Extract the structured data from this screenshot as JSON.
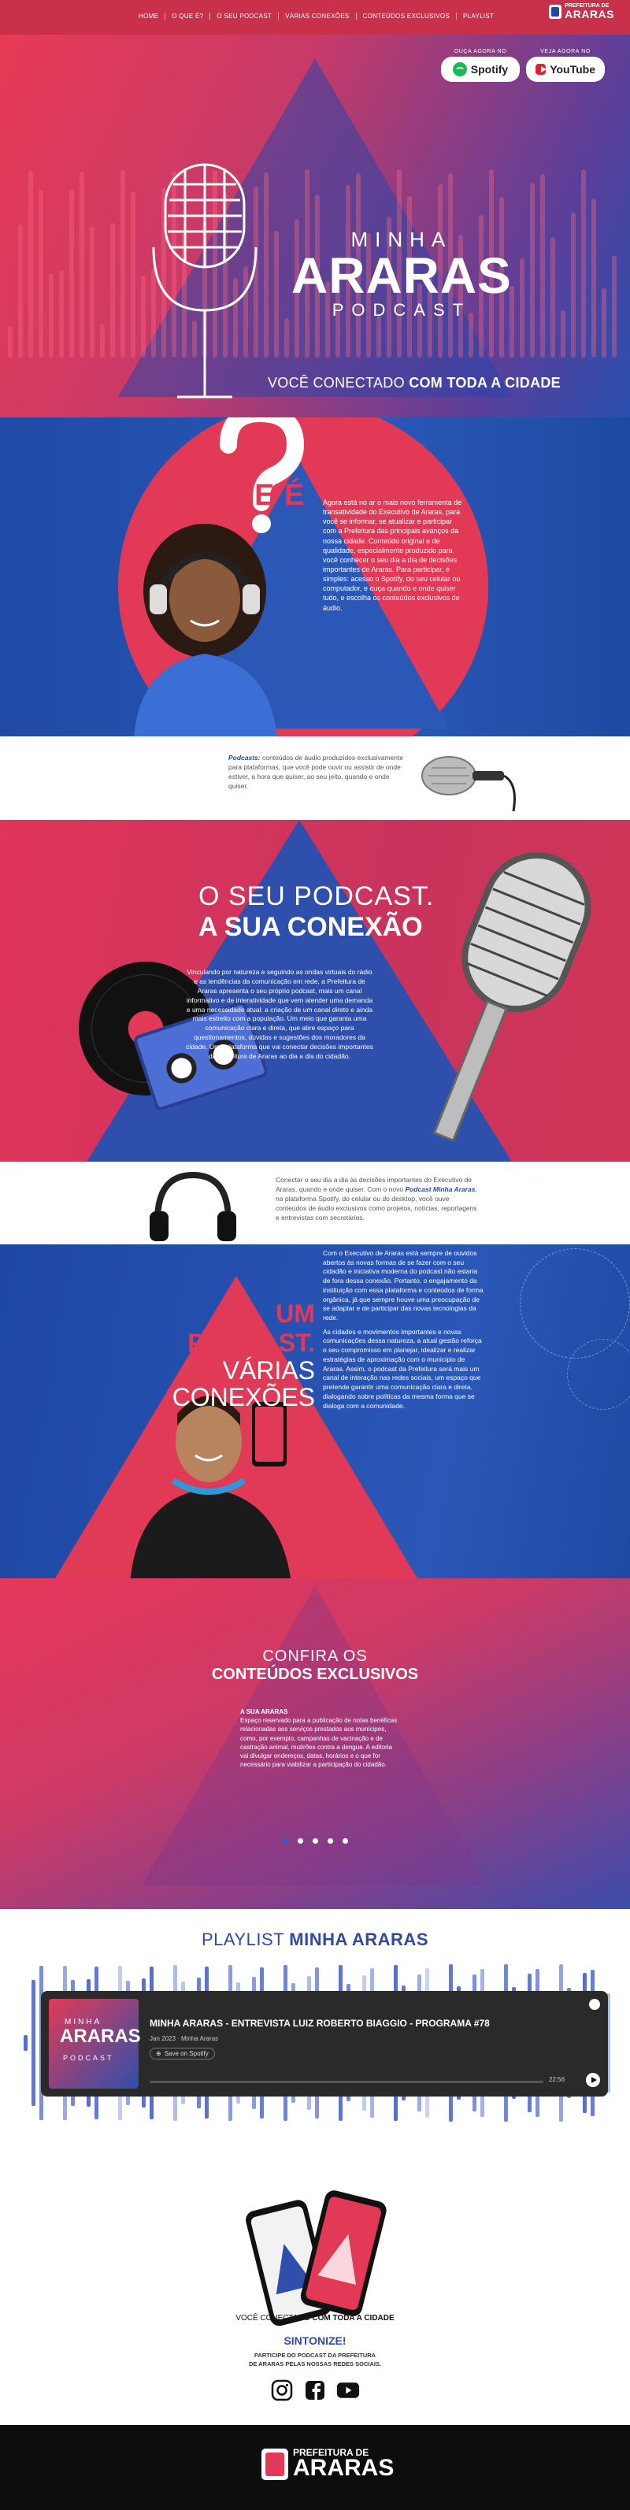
{
  "nav": {
    "links": [
      "HOME",
      "O QUE É?",
      "O SEU PODCAST",
      "VÁRIAS CONEXÕES",
      "CONTEÚDOS EXCLUSIVOS",
      "PLAYLIST"
    ],
    "logo_line1": "PREFEITURA DE",
    "logo_line2": "ARARAS"
  },
  "hero": {
    "spotify_label": "OUÇA AGORA NO",
    "spotify_name": "Spotify",
    "youtube_label": "VEJA AGORA NO",
    "youtube_name": "YouTube",
    "title_top": "MINHA",
    "title_main": "ARARAS",
    "title_bottom": "PODCAST",
    "tagline_part1": "VOCÊ CONECTADO",
    "tagline_part2": "COM TODA A CIDADE"
  },
  "oque": {
    "title": "O QUE É",
    "text": "Agora está no ar o mais novo ferramenta de transatividade do Executivo de Araras, para você se informar, se atualizar e participar com a Prefeitura das principais avanços da nossa cidade. Conteúdo original e de qualidade, especialmente produzido para você conhecer o seu dia a dia de decisões importantes de Araras. Para participar, é simples: acesso o Spotify, do seu celular ou computador, e ouça quando e onde quiser tudo, e escolha os conteúdos exclusivos de áudio.",
    "bottom_lead": "Podcasts:",
    "bottom_text": "conteúdos de áudio produzidos exclusivamente para plataformas, que você pode ouvir ou assistir de onde estiver, a hora que quiser, ao seu jeito, quando e onde quiser."
  },
  "seu": {
    "title_line1": "O SEU PODCAST.",
    "title_line2": "A SUA CONEXÃO",
    "text": "Vinculando por natureza e seguindo as ondas virtuais do rádio e as tendências da comunicação em rede, a Prefeitura de Araras apresenta o seu próprio podcast, mais um canal informativo e de interatividade que vem atender uma demanda e uma necessidade atual: a criação de um canal direto e ainda mais estreito com a população. Um meio que garanta uma comunicação clara e direta, que abre espaço para questionamentos, dúvidas e sugestões dos moradores da cidade. Uma plataforma que vai conectar decisões importantes da Prefeitura de Araras ao dia a dia do cidadão.",
    "bottom_text_start": "Conectar o seu dia a dia às decisões importantes do Executivo de Araras, quando e onde quiser. Com o novo",
    "bottom_lead": "Podcast Minha Araras",
    "bottom_text_end": ", na plataforma Spotify, do celular ou do desktop, você ouve conteúdos de áudio exclusivos como projetos, notícias, reportagens e entrevistas com secretários."
  },
  "um": {
    "title_line1": "UM PODCAST.",
    "title_line2": "VÁRIAS",
    "title_line3": "CONEXÕES",
    "paragraphs": [
      "Com o Executivo de Araras está sempre de ouvidos abertos às novas formas de se fazer com o seu cidadão e iniciativa moderna do podcast não estaria de fora dessa conexão. Portanto, o engajamento da instituição com essa plataforma e conteúdos de forma orgânica, já que sempre houve uma preocupação de se adaptar e de participar das novas tecnologias da rede.",
      "As cidades e movimentos importantes e novas comunicações dessa natureza, a atual gestão reforça o seu compromisso em planejar, idealizar e realizar estratégias de aproximação com o município de Araras. Assim, o podcast da Prefeitura será mais um canal de interação nas redes sociais, um espaço que pretende garantir uma comunicação clara e direta, dialogando sobre políticas da mesma forma que se dialoga com a comunidade."
    ]
  },
  "confira": {
    "title_line1": "CONFIRA OS",
    "title_line2": "CONTEÚDOS EXCLUSIVOS",
    "item_title": "A SUA ARARAS",
    "item_text": "Espaço reservado para a publicação de notas benéficas relacionadas aos serviços prestados aos munícipes, como, por exemplo, campanhas de vacinação e de castração animal, mutirões contra a dengue. A editoria vai divulgar endereços, datas, horários e o que for necessário para viabilizar a participação do cidadão.",
    "slides_total": 5,
    "active_slide": 1
  },
  "playlist": {
    "title_part1": "PLAYLIST",
    "title_part2": "MINHA ARARAS",
    "cover_top": "MINHA",
    "cover_main": "ARARAS",
    "cover_bottom": "PODCAST",
    "episode_title": "MINHA ARARAS - ENTREVISTA LUIZ ROBERTO BIAGGIO - PROGRAMA #78",
    "episode_sub": "Jan 2023 · Minha Araras",
    "save_label": "Save on Spotify",
    "time": "22:56"
  },
  "sintonize": {
    "tagline_part1": "VOCÊ CONECTADO",
    "tagline_part2": "COM TODA A CIDADE",
    "title": "SINTONIZE!",
    "subtitle_line1": "PARTICIPE DO PODCAST DA PREFEITURA",
    "subtitle_line2": "DE ARARAS PELAS NOSSAS REDES SOCIAIS."
  },
  "footer": {
    "logo_line1": "PREFEITURA DE",
    "logo_line2": "ARARAS"
  },
  "colors": {
    "red": "#e23a56",
    "blue": "#2e4fac",
    "dark": "#0d0d0d"
  },
  "icons": [
    "spotify-icon",
    "youtube-icon",
    "microphone-icon",
    "question-mark-icon",
    "instagram-icon",
    "facebook-icon",
    "youtube-social-icon",
    "play-icon"
  ]
}
